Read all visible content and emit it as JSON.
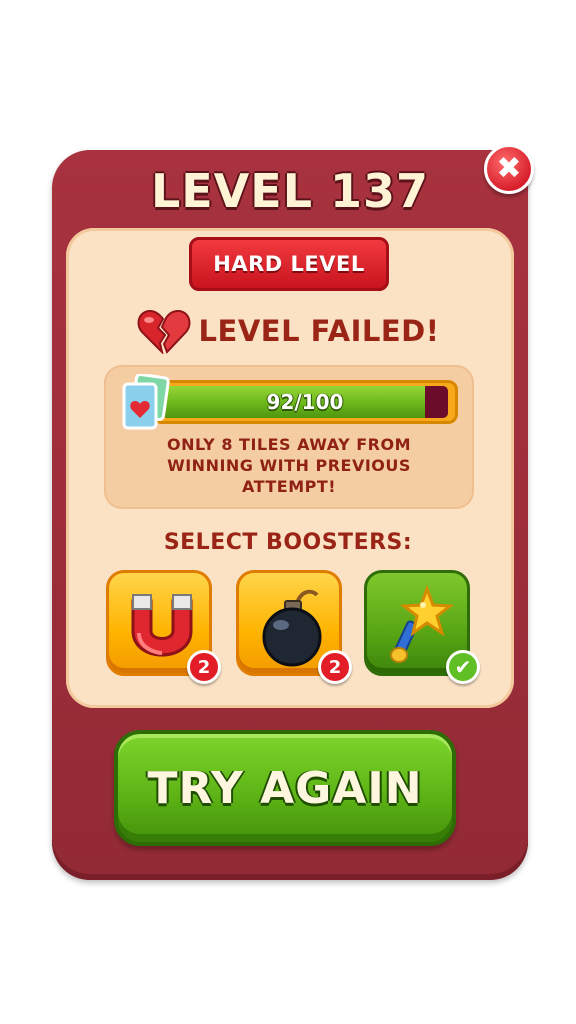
{
  "popup": {
    "title": "LEVEL 137",
    "close_icon": "close-icon",
    "difficulty_badge": "HARD LEVEL",
    "status_text": "LEVEL FAILED!",
    "status_icon": "broken-heart-icon"
  },
  "progress": {
    "label": "92/100",
    "fraction": 0.92,
    "icon": "tile-cards-icon",
    "hint": "ONLY 8 TILES AWAY FROM WINNING WITH PREVIOUS ATTEMPT!"
  },
  "boosters": {
    "label": "SELECT BOOSTERS:",
    "items": [
      {
        "icon": "magnet-icon",
        "count": "2",
        "selected": false
      },
      {
        "icon": "bomb-icon",
        "count": "2",
        "selected": false
      },
      {
        "icon": "magic-wand-icon",
        "count": "",
        "selected": true
      }
    ]
  },
  "actions": {
    "try_again": "TRY AGAIN"
  },
  "colors": {
    "panel": "#a8323f",
    "inner": "#fbe2c5",
    "badge_red": "#e21d27",
    "button_green": "#5fb516",
    "progress_fill": "#6bb61c"
  }
}
